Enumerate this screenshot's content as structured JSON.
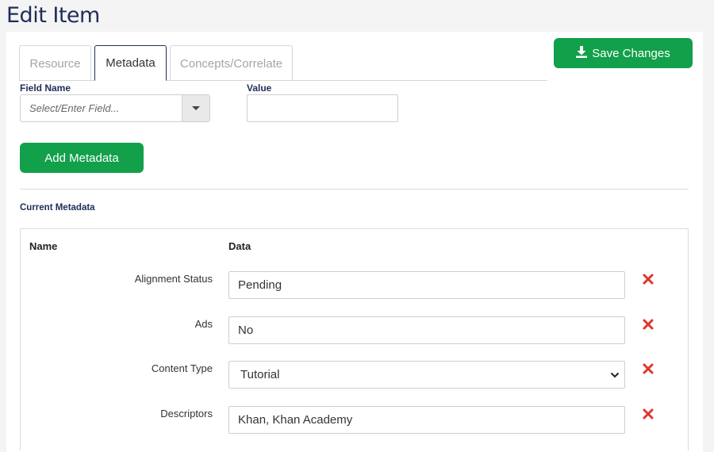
{
  "page": {
    "title": "Edit Item"
  },
  "tabs": [
    {
      "label": "Resource",
      "active": false
    },
    {
      "label": "Metadata",
      "active": true
    },
    {
      "label": "Concepts/Correlate",
      "active": false
    }
  ],
  "toolbar": {
    "save_label": "Save Changes",
    "save_icon": "download-icon"
  },
  "form": {
    "field_name_label": "Field Name",
    "field_name_placeholder": "Select/Enter Field...",
    "value_label": "Value",
    "value": "",
    "add_label": "Add Metadata"
  },
  "current": {
    "title": "Current Metadata",
    "headers": {
      "name": "Name",
      "data": "Data"
    },
    "rows": [
      {
        "name": "Alignment Status",
        "value": "Pending",
        "kind": "text"
      },
      {
        "name": "Ads",
        "value": "No",
        "kind": "text"
      },
      {
        "name": "Content Type",
        "value": "Tutorial",
        "kind": "select"
      },
      {
        "name": "Descriptors",
        "value": "Khan, Khan Academy",
        "kind": "text"
      }
    ]
  },
  "colors": {
    "primary_green": "#12a04a",
    "navy": "#1f2d5a",
    "delete_red": "#e0352b"
  }
}
